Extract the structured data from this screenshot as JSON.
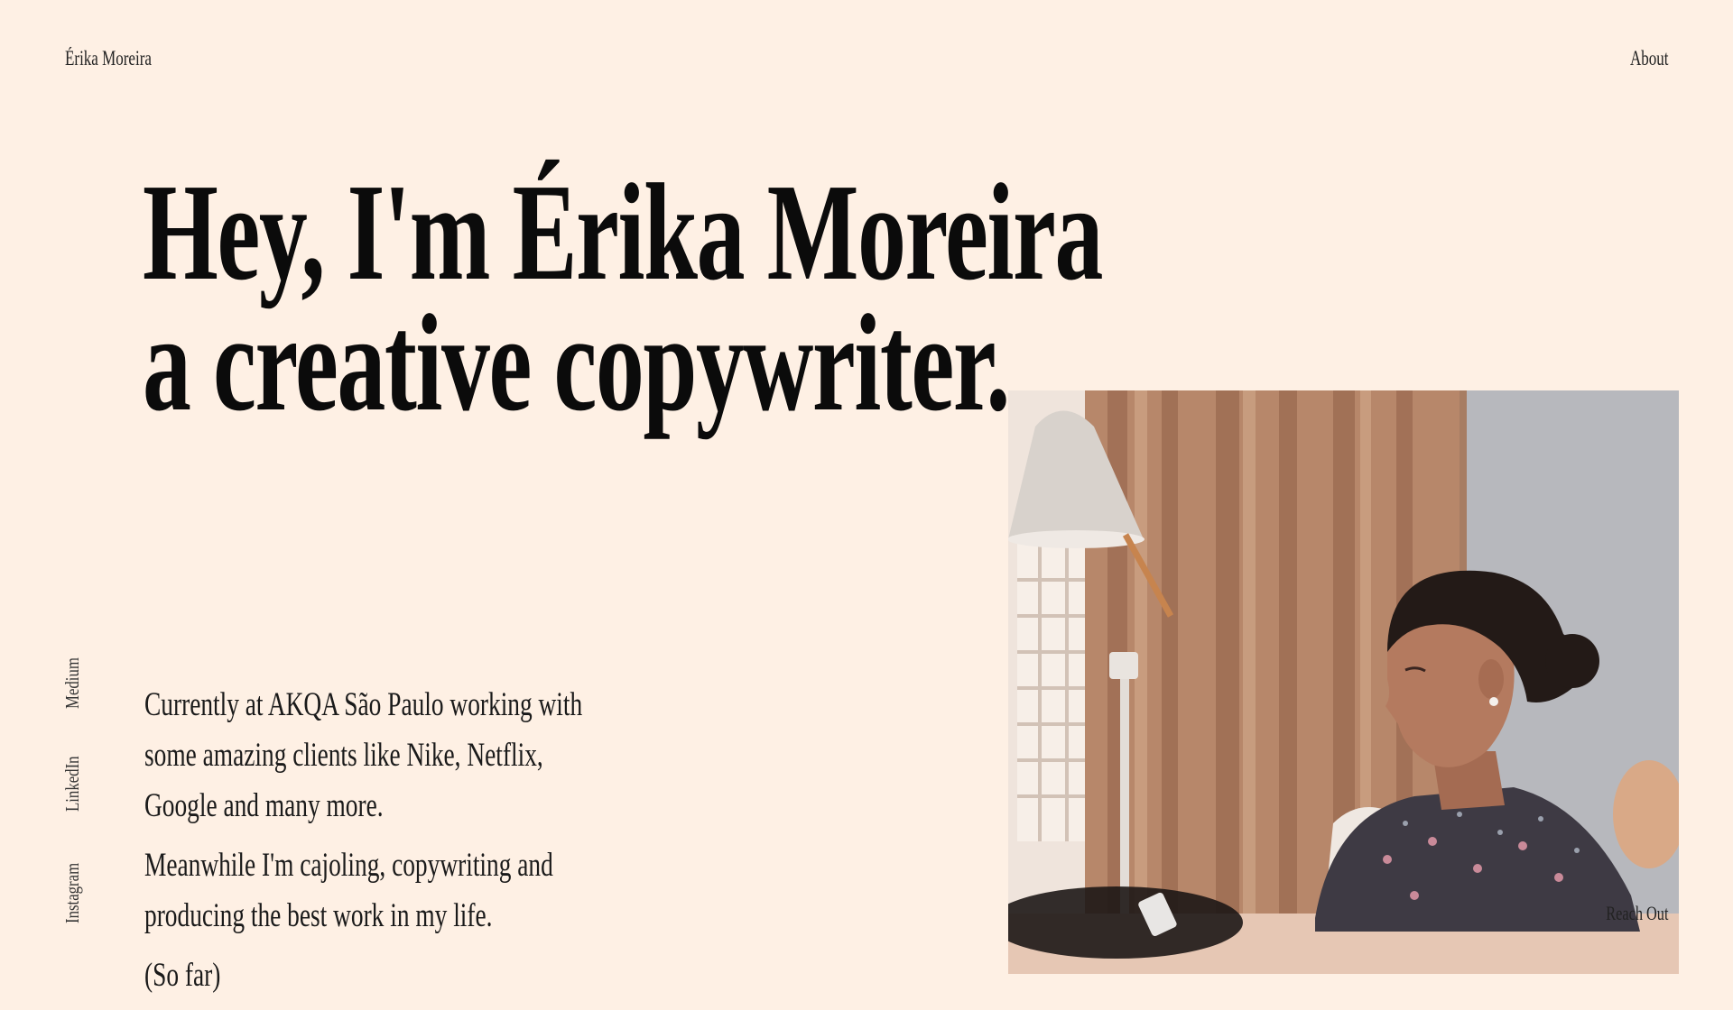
{
  "header": {
    "brand": "Érika Moreira",
    "nav_about": "About"
  },
  "hero": {
    "line1": "Hey, I'm Érika Moreira",
    "line2": "a creative copywriter."
  },
  "social": {
    "medium": "Medium",
    "linkedin": "LinkedIn",
    "instagram": "Instagram"
  },
  "bio": {
    "p1_line1": "Currently at AKQA São Paulo working with",
    "p1_line2": "some amazing clients like Nike, Netflix,",
    "p1_line3": "Google and many more.",
    "p2_line1": "Meanwhile I'm cajoling, copywriting and",
    "p2_line2": "producing the best work in my life.",
    "p3": "(So far)"
  },
  "photo": {
    "reach_out": "Reach Out"
  },
  "colors": {
    "background": "#fef0e4",
    "text": "#111111"
  }
}
